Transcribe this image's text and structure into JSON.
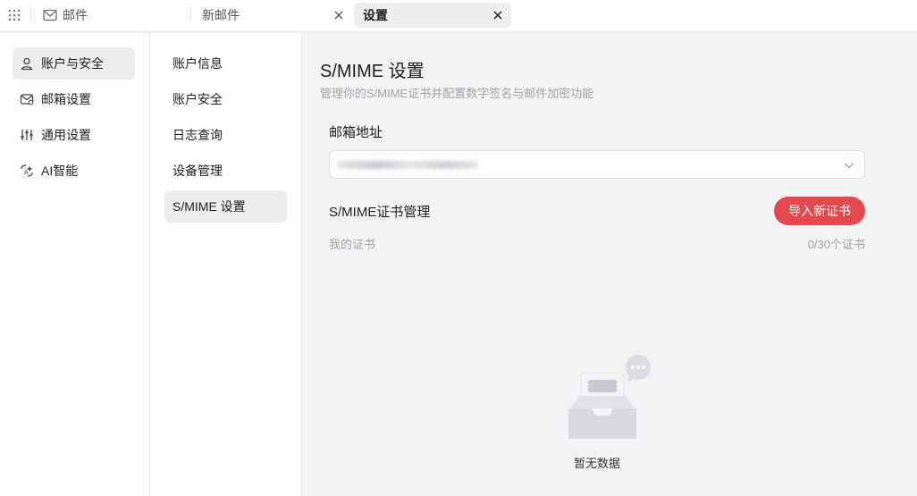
{
  "tabs": [
    {
      "label": "邮件",
      "icon": "mail-icon"
    },
    {
      "label": "新邮件",
      "icon": "close-icon"
    },
    {
      "label": "设置",
      "icon": "close-icon",
      "active": true
    }
  ],
  "left_nav": {
    "items": [
      {
        "label": "账户与安全",
        "icon": "user-icon",
        "active": true
      },
      {
        "label": "邮箱设置",
        "icon": "mailbox-icon"
      },
      {
        "label": "通用设置",
        "icon": "sliders-icon"
      },
      {
        "label": "AI智能",
        "icon": "ai-icon"
      }
    ]
  },
  "sub_nav": {
    "items": [
      {
        "label": "账户信息"
      },
      {
        "label": "账户安全"
      },
      {
        "label": "日志查询"
      },
      {
        "label": "设备管理"
      },
      {
        "label": "S/MIME 设置",
        "active": true
      }
    ]
  },
  "main": {
    "title": "S/MIME 设置",
    "subtitle": "管理你的S/MIME证书并配置数字签名与邮件加密功能",
    "mailbox_label": "邮箱地址",
    "cert_section_title": "S/MIME证书管理",
    "import_button": "导入新证书",
    "my_certs_label": "我的证书",
    "cert_count": "0/30个证书",
    "empty_text": "暂无数据"
  },
  "colors": {
    "accent": "#e5484d",
    "muted_text": "#a3a3a8",
    "active_bg": "#ededf0"
  }
}
